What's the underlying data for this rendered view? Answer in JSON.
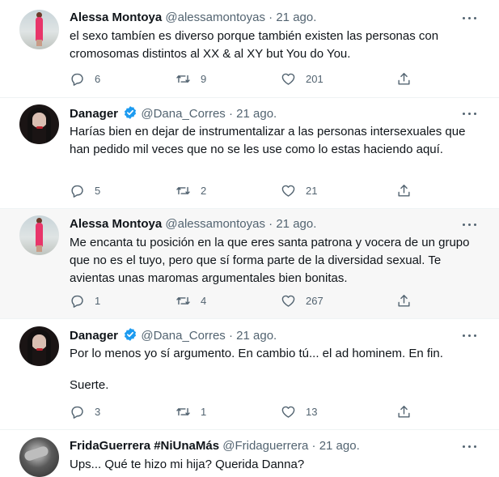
{
  "tweets": [
    {
      "name": "Alessa Montoya",
      "handle": "@alessamontoyas",
      "sep": "·",
      "time": "21 ago.",
      "verified": false,
      "paragraphs": [
        "el sexo tambíen es diverso porque también existen las personas con cromosomas distintos al XX & al XY but You do You."
      ],
      "replies": "6",
      "retweets": "9",
      "likes": "201"
    },
    {
      "name": "Danager",
      "handle": "@Dana_Corres",
      "sep": "·",
      "time": "21 ago.",
      "verified": true,
      "paragraphs": [
        "Harías bien en dejar de instrumentalizar a las personas intersexuales que han pedido mil veces que no se les use como lo estas haciendo aquí."
      ],
      "replies": "5",
      "retweets": "2",
      "likes": "21"
    },
    {
      "name": "Alessa Montoya",
      "handle": "@alessamontoyas",
      "sep": "·",
      "time": "21 ago.",
      "verified": false,
      "paragraphs": [
        "Me encanta tu posición en la que eres santa patrona y vocera de un grupo que no es el tuyo, pero que sí forma parte de la diversidad sexual. Te avientas unas maromas argumentales bien bonitas."
      ],
      "replies": "1",
      "retweets": "4",
      "likes": "267"
    },
    {
      "name": "Danager",
      "handle": "@Dana_Corres",
      "sep": "·",
      "time": "21 ago.",
      "verified": true,
      "paragraphs": [
        "Por lo menos yo sí argumento. En cambio tú... el ad hominem. En fin.",
        "Suerte."
      ],
      "replies": "3",
      "retweets": "1",
      "likes": "13"
    },
    {
      "name": "FridaGuerrera #NiUnaMás",
      "handle": "@Fridaguerrera",
      "sep": "·",
      "time": "21 ago.",
      "verified": false,
      "paragraphs": [
        "Ups... Qué te hizo mi hija? Querida Danna?"
      ]
    }
  ],
  "icons": {
    "reply": "reply-icon",
    "retweet": "retweet-icon",
    "like": "heart-icon",
    "share": "share-icon",
    "more": "more-options-icon",
    "verified": "verified-badge-icon"
  },
  "colors": {
    "text": "#0f1419",
    "secondary": "#536471",
    "verified": "#1d9bf0",
    "highlight_bg": "#f7f7f7",
    "thread_line": "#cfd9de"
  }
}
